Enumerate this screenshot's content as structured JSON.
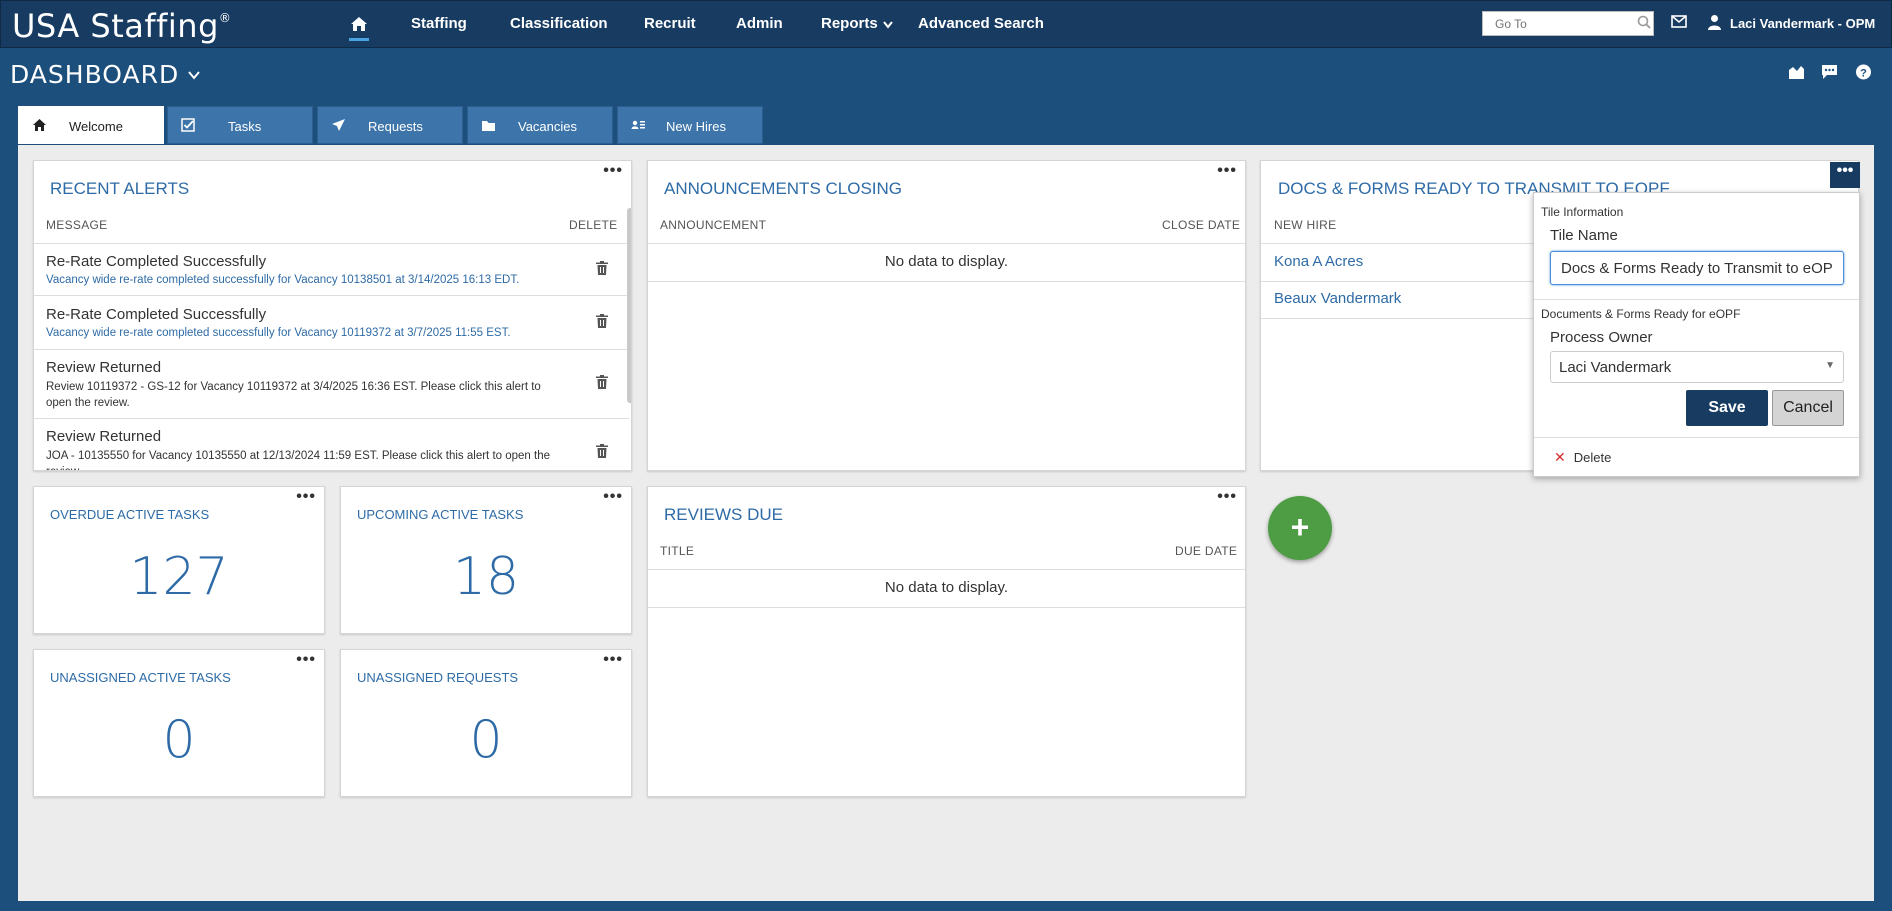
{
  "app": {
    "logo": "USA Staffing",
    "logo_reg": "®",
    "nav": [
      "Staffing",
      "Classification",
      "Recruit",
      "Admin",
      "Reports",
      "Advanced Search"
    ],
    "goto_placeholder": "Go To",
    "user": "Laci Vandermark - OPM"
  },
  "dashboard": {
    "title": "DASHBOARD",
    "tabs": [
      {
        "label": "Welcome",
        "icon": "home-icon"
      },
      {
        "label": "Tasks",
        "icon": "checkbox-icon"
      },
      {
        "label": "Requests",
        "icon": "paper-plane-icon"
      },
      {
        "label": "Vacancies",
        "icon": "folder-icon"
      },
      {
        "label": "New Hires",
        "icon": "id-card-icon"
      }
    ]
  },
  "tiles": {
    "recent_alerts": {
      "title": "RECENT ALERTS",
      "col_message": "MESSAGE",
      "col_delete": "DELETE",
      "items": [
        {
          "title": "Re-Rate Completed Successfully",
          "body": "Vacancy wide re-rate completed successfully for Vacancy 10138501 at 3/14/2025 16:13 EDT."
        },
        {
          "title": "Re-Rate Completed Successfully",
          "body": "Vacancy wide re-rate completed successfully for Vacancy 10119372 at 3/7/2025 11:55 EST."
        },
        {
          "title": "Review Returned",
          "body": "Review 10119372 - GS-12 for Vacancy 10119372 at 3/4/2025 16:36 EST. Please click this alert to open the review."
        },
        {
          "title": "Review Returned",
          "body": "JOA - 10135550 for Vacancy 10135550 at 12/13/2024 11:59 EST. Please click this alert to open the review."
        }
      ]
    },
    "announcements": {
      "title": "ANNOUNCEMENTS CLOSING",
      "col1": "ANNOUNCEMENT",
      "col2": "CLOSE DATE",
      "empty": "No data to display."
    },
    "docs": {
      "title": "DOCS & FORMS READY TO TRANSMIT TO EOPF",
      "col1": "NEW HIRE",
      "rows": [
        "Kona A Acres",
        "Beaux Vandermark"
      ]
    },
    "overdue": {
      "title": "OVERDUE ACTIVE TASKS",
      "value": "127"
    },
    "upcoming": {
      "title": "UPCOMING ACTIVE TASKS",
      "value": "18"
    },
    "unassigned_tasks": {
      "title": "UNASSIGNED ACTIVE TASKS",
      "value": "0"
    },
    "unassigned_requests": {
      "title": "UNASSIGNED REQUESTS",
      "value": "0"
    },
    "reviews": {
      "title": "REVIEWS DUE",
      "col1": "TITLE",
      "col2": "DUE DATE",
      "empty": "No data to display."
    }
  },
  "popup": {
    "section1": "Tile Information",
    "tile_name_label": "Tile Name",
    "tile_name_value": "Docs & Forms Ready to Transmit to eOPF",
    "section2": "Documents & Forms Ready for eOPF",
    "owner_label": "Process Owner",
    "owner_value": "Laci Vandermark",
    "save": "Save",
    "cancel": "Cancel",
    "delete": "Delete"
  },
  "dots": "•••",
  "fab": "+"
}
